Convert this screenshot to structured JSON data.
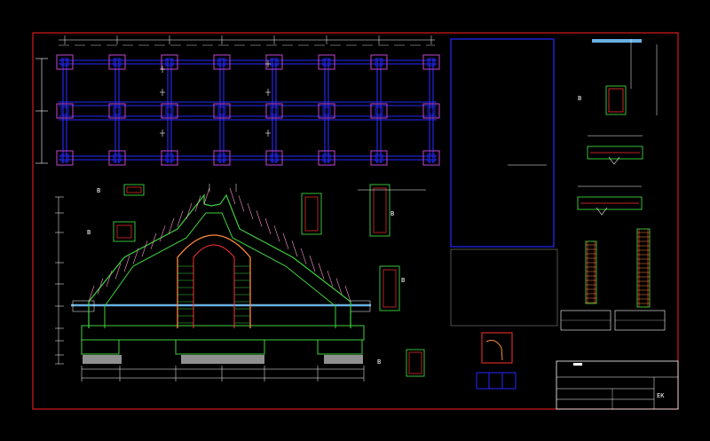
{
  "sheet": {
    "background": "#000000",
    "border_color": "#ff2020",
    "colors": {
      "grid_blue": "#2828ff",
      "column_magenta": "#b040c0",
      "dim_white": "#ffffff",
      "rebar_green": "#40d040",
      "rebar_red": "#ff3030",
      "rebar_orange": "#ff8a3a",
      "slab_cyan": "#6ab0e0"
    }
  },
  "sections": {
    "left_label_1": "B",
    "left_label_2": "B",
    "right_label_1": "B",
    "right_label_2": "B",
    "detail_label_a": "B",
    "detail_label_b": "B",
    "small_label": "B",
    "small_label_2": "B"
  },
  "title_block": {
    "row1": "",
    "row2": "",
    "row3": "",
    "logo": "EK"
  }
}
